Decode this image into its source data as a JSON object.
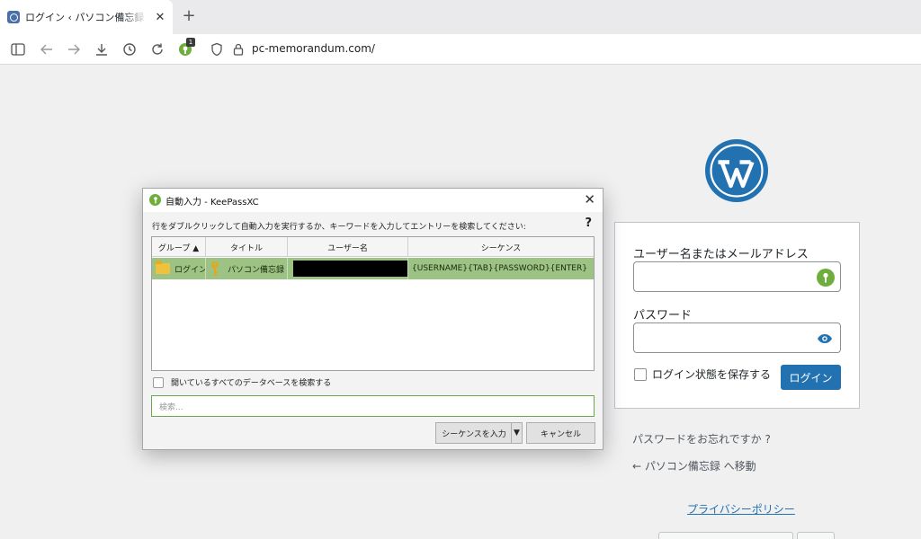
{
  "browser": {
    "tab": {
      "title": "ログイン ‹ パソコン備忘録 — WordPress",
      "close": "✕"
    },
    "new_tab": "+",
    "extension_badge": "1",
    "address": "pc-memorandum.com/"
  },
  "wordpress": {
    "username_label": "ユーザー名またはメールアドレス",
    "password_label": "パスワード",
    "remember_label": "ログイン状態を保存する",
    "login_button": "ログイン",
    "lost_password": "パスワードをお忘れですか ?",
    "back_link": "← パソコン備忘録 へ移動",
    "privacy_link": "プライバシーポリシー",
    "brand_color": "#2271b1"
  },
  "keepass": {
    "title": "自動入力 - KeePassXC",
    "close": "✕",
    "instruction": "行をダブルクリックして自動入力を実行するか、キーワードを入力してエントリーを検索してください:",
    "help": "?",
    "columns": [
      "グループ ▲",
      "タイトル",
      "ユーザー名",
      "シーケンス"
    ],
    "rows": [
      {
        "group": "ログイン",
        "title": "パソコン備忘録",
        "username": "",
        "sequence": "{USERNAME}{TAB}{PASSWORD}{ENTER}"
      }
    ],
    "search_all_label": "開いているすべてのデータベースを検索する",
    "search_placeholder": "検索...",
    "sequence_button": "シーケンスを入力",
    "dropdown_arrow": "▼",
    "cancel_button": "キャンセル",
    "selection_color": "#9cc383"
  }
}
